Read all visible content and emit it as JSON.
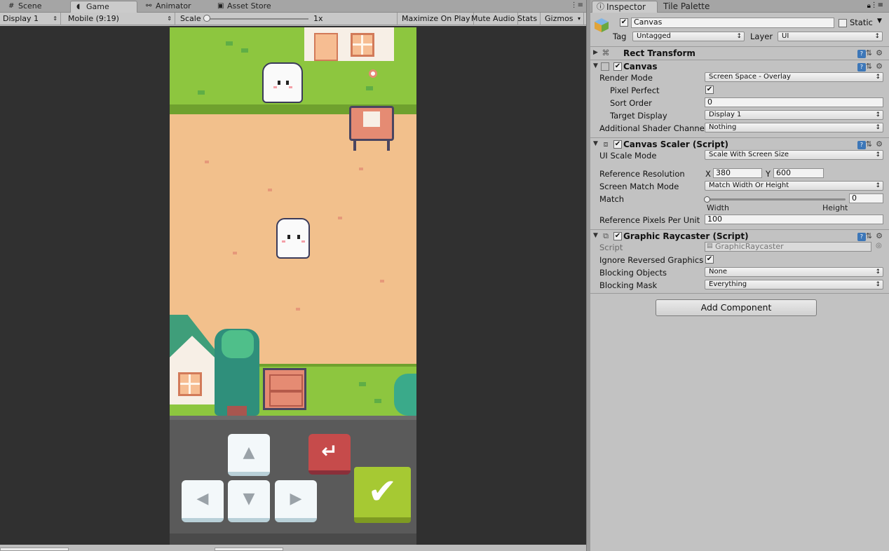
{
  "game_window": {
    "tabs": [
      {
        "label": "Scene",
        "icon": "hash-icon"
      },
      {
        "label": "Game",
        "icon": "pacman-icon"
      },
      {
        "label": "Animator",
        "icon": "nodes-icon"
      },
      {
        "label": "Asset Store",
        "icon": "bag-icon"
      }
    ],
    "toolbar": {
      "display": "Display 1",
      "aspect": "Mobile (9:19)",
      "scale_label": "Scale",
      "scale_value": "1x",
      "maximize": "Maximize On Play",
      "mute": "Mute Audio",
      "stats": "Stats",
      "gizmos": "Gizmos"
    },
    "game": {
      "keys": {
        "up": "▲",
        "left": "◀",
        "down": "▼",
        "right": "▶",
        "back": "↵",
        "confirm": "✔"
      }
    }
  },
  "inspector": {
    "tabs": [
      {
        "label": "Inspector",
        "icon": "info-icon"
      },
      {
        "label": "Tile Palette"
      }
    ],
    "object": {
      "enabled": true,
      "name": "Canvas",
      "static_label": "Static",
      "static": false,
      "tag_label": "Tag",
      "tag": "Untagged",
      "layer_label": "Layer",
      "layer": "UI"
    },
    "rect_transform": {
      "title": "Rect Transform"
    },
    "canvas": {
      "title": "Canvas",
      "enabled": true,
      "render_mode_label": "Render Mode",
      "render_mode": "Screen Space - Overlay",
      "pixel_perfect_label": "Pixel Perfect",
      "pixel_perfect": true,
      "sort_order_label": "Sort Order",
      "sort_order": "0",
      "target_display_label": "Target Display",
      "target_display": "Display 1",
      "shader_channels_label": "Additional Shader Channe",
      "shader_channels": "Nothing"
    },
    "canvas_scaler": {
      "title": "Canvas Scaler (Script)",
      "enabled": true,
      "ui_scale_mode_label": "UI Scale Mode",
      "ui_scale_mode": "Scale With Screen Size",
      "ref_res_label": "Reference Resolution",
      "x_label": "X",
      "x": "380",
      "y_label": "Y",
      "y": "600",
      "match_mode_label": "Screen Match Mode",
      "match_mode": "Match Width Or Height",
      "match_label": "Match",
      "match_value": "0",
      "match_level": 0,
      "width_label": "Width",
      "height_label": "Height",
      "ppu_label": "Reference Pixels Per Unit",
      "ppu": "100"
    },
    "graphic_raycaster": {
      "title": "Graphic Raycaster (Script)",
      "enabled": true,
      "script_label": "Script",
      "script": "GraphicRaycaster",
      "ignore_reversed_label": "Ignore Reversed Graphics",
      "ignore_reversed": true,
      "blocking_objects_label": "Blocking Objects",
      "blocking_objects": "None",
      "blocking_mask_label": "Blocking Mask",
      "blocking_mask": "Everything"
    },
    "add_component": "Add Component"
  },
  "colors": {
    "grass": "#8dc63f",
    "dirt": "#f2c08c",
    "confirm_key": "#a6c933",
    "back_key": "#c64b4b",
    "help_icon": "#3d77b8"
  }
}
